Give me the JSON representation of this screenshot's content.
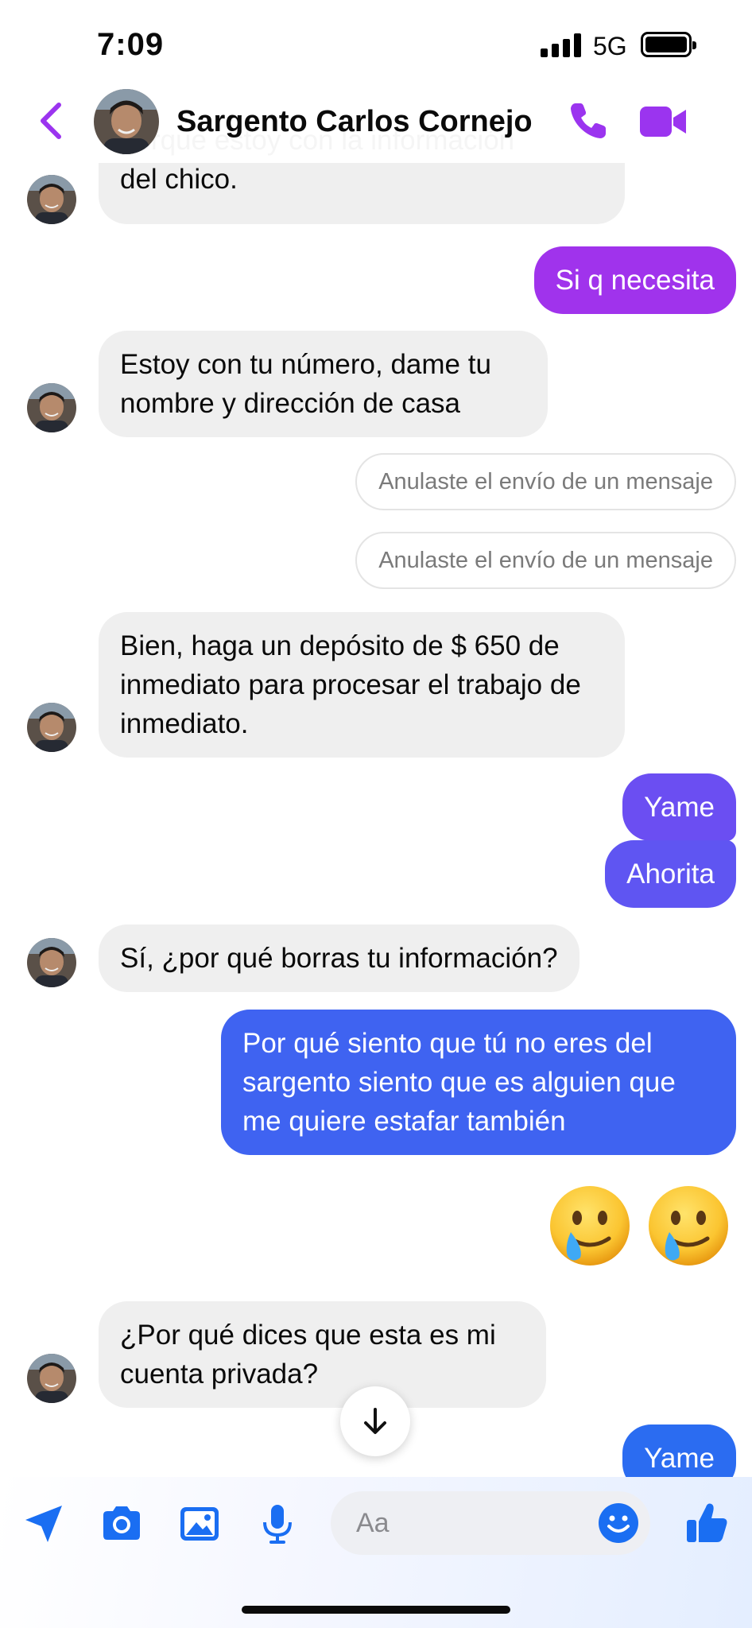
{
  "status_bar": {
    "time": "7:09",
    "network": "5G"
  },
  "header": {
    "contact_name": "Sargento Carlos Cornejo"
  },
  "messages": {
    "m0": "porque estoy con la información del chico.",
    "m1": "Si q necesita",
    "m2": "Estoy con tu número, dame tu nombre y dirección de casa",
    "m3": "Anulaste el envío de un mensaje",
    "m4": "Anulaste el envío de un mensaje",
    "m5": "Bien, haga un depósito de $ 650 de inmediato para procesar el trabajo de inmediato.",
    "m6": "Yame",
    "m7": "Ahorita",
    "m8": "Sí, ¿por qué borras tu información?",
    "m9": "Por qué siento que tú no eres del sargento siento que es alguien que me quiere estafar también",
    "m10": "¿Por qué dices que esta es mi cuenta privada?",
    "m11": "Yame"
  },
  "emojis": [
    "face-holding-back-tears",
    "face-holding-back-tears"
  ],
  "composer": {
    "placeholder": "Aa"
  },
  "colors": {
    "accent_purple": "#9b34ef",
    "incoming_bubble": "#efefef",
    "outgoing_purple": "#a033ec",
    "outgoing_violet": "#6b4ef2",
    "outgoing_blue": "#3f63f1",
    "composer_blue": "#1a6ef2"
  }
}
